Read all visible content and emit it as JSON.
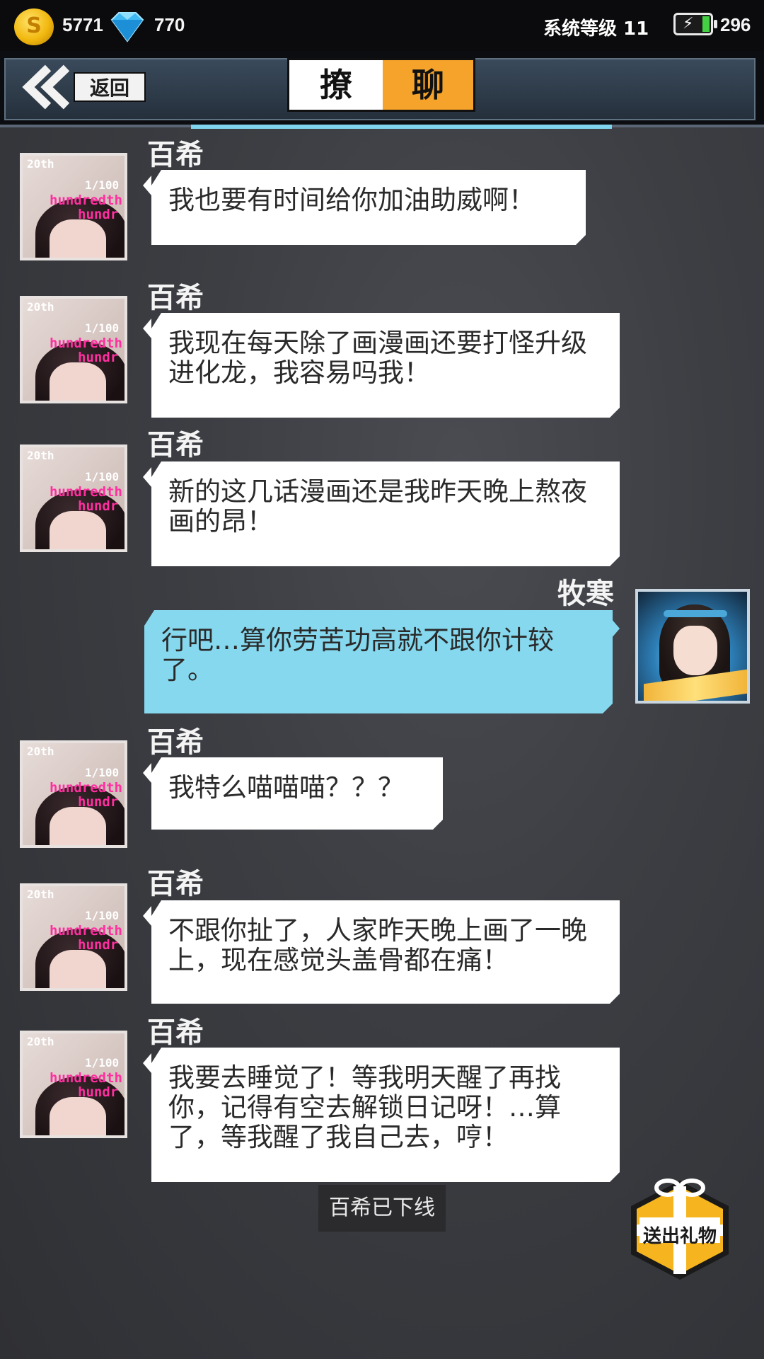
{
  "top_bar": {
    "coins": "5771",
    "diamonds": "770",
    "system_level": "系统等级 11",
    "energy": "296",
    "coin_icon": "coin-icon",
    "diamond_icon": "diamond-icon",
    "battery_icon": "battery-icon"
  },
  "header": {
    "back_label": "返回",
    "title_part1": "撩",
    "title_part2": "聊",
    "accent_color": "#f5a32a"
  },
  "messages": [
    {
      "sender": "百希",
      "side": "left",
      "text": "我也要有时间给你加油助威啊！"
    },
    {
      "sender": "百希",
      "side": "left",
      "text": "我现在每天除了画漫画还要打怪升级进化龙，我容易吗我！"
    },
    {
      "sender": "百希",
      "side": "left",
      "text": "新的这几话漫画还是我昨天晚上熬夜画的昂！"
    },
    {
      "sender": "牧寒",
      "side": "right",
      "text": "行吧…算你劳苦功高就不跟你计较了。"
    },
    {
      "sender": "百希",
      "side": "left",
      "text": "我特么喵喵喵？？？"
    },
    {
      "sender": "百希",
      "side": "left",
      "text": "不跟你扯了，人家昨天晚上画了一晚上，现在感觉头盖骨都在痛！"
    },
    {
      "sender": "百希",
      "side": "left",
      "text": "我要去睡觉了！等我明天醒了再找你，记得有空去解锁日记呀！…算了，等我醒了我自己去，哼！"
    }
  ],
  "avatar_text": {
    "line1": "20th",
    "line2": "1/100",
    "line3": "hundredth",
    "line4": "hundr"
  },
  "status": {
    "offline_text": "百希已下线"
  },
  "gift_button": {
    "label": "送出礼物"
  },
  "colors": {
    "left_bubble": "#ffffff",
    "right_bubble": "#86d8ee",
    "background": "#3c3e43"
  }
}
